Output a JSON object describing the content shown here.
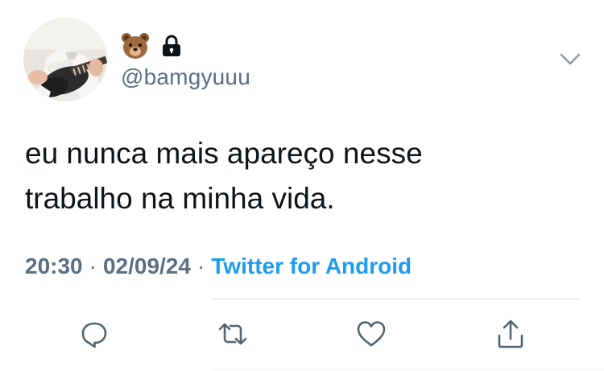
{
  "author": {
    "handle": "@bamgyuuu",
    "name_icons": [
      "bear-face-icon",
      "lock-icon"
    ]
  },
  "tweet": {
    "text_line1": "eu nunca mais apareço nesse",
    "text_line2": "trabalho na minha vida.",
    "time": "20:30",
    "date": "02/09/24",
    "separator": "·",
    "source": "Twitter for Android"
  },
  "colors": {
    "text": "#0f1419",
    "secondary": "#5b7083",
    "link": "#1d9bf0",
    "divider": "#dcdfe3",
    "icon": "#536471"
  },
  "actions": [
    "reply-icon",
    "retweet-icon",
    "like-icon",
    "share-icon"
  ]
}
